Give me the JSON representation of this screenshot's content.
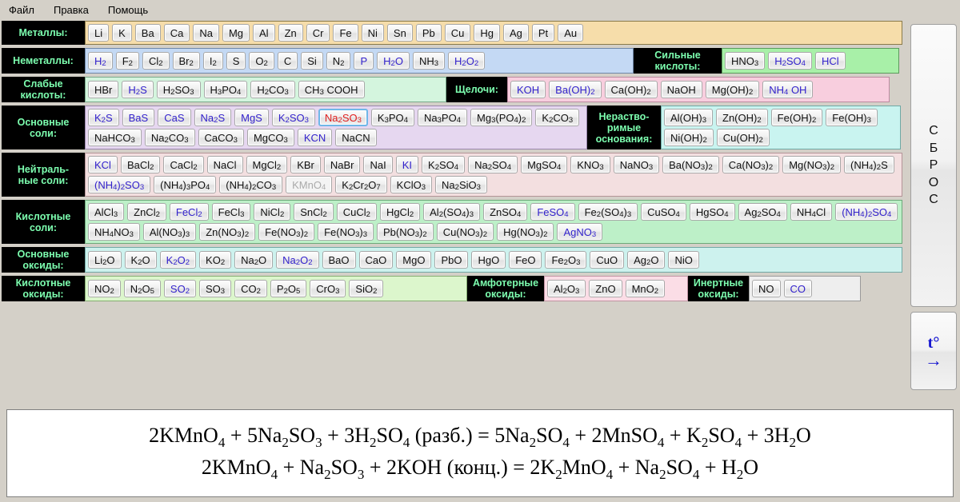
{
  "menu": {
    "items": [
      {
        "label": "Файл",
        "name": "menu-file"
      },
      {
        "label": "Правка",
        "name": "menu-edit"
      },
      {
        "label": "Помощь",
        "name": "menu-help"
      }
    ]
  },
  "sidebar": {
    "reset_label": "СБРОС",
    "reset_chars": [
      "С",
      "Б",
      "Р",
      "О",
      "С"
    ],
    "temp_label": "t°",
    "temp_arrow": "→"
  },
  "colors": {
    "label_bg": "#000000",
    "label_text": "#7dffb0",
    "selected_text": "#e02020",
    "selected_border": "#6fb7e8",
    "blue_text": "#3322cc",
    "disabled_text": "#aaaaaa",
    "metals_panel": "#f6ddaa",
    "nonmetals_panel": "#c4d9f4",
    "weak_acids_panel": "#d4f5de",
    "strong_acids_panel": "#a8f0a8",
    "alkalis_panel": "#f8cede",
    "base_salts_panel": "#e6d7f0",
    "insoluble_bases_panel": "#c9f4f0",
    "neutral_salts_panel": "#f3dfe0",
    "acid_salts_panel": "#bdf0c8",
    "base_oxides_panel": "#cdf2ee",
    "acid_oxides_panel": "#dcf6cc",
    "amphoteric_oxides_panel": "#fbdde6",
    "inert_oxides_panel": "#eeeeee"
  },
  "groups": {
    "metals": {
      "label": "Металлы:",
      "items": [
        {
          "f": "Li"
        },
        {
          "f": "K"
        },
        {
          "f": "Ba"
        },
        {
          "f": "Ca"
        },
        {
          "f": "Na"
        },
        {
          "f": "Mg"
        },
        {
          "f": "Al"
        },
        {
          "f": "Zn"
        },
        {
          "f": "Cr"
        },
        {
          "f": "Fe"
        },
        {
          "f": "Ni"
        },
        {
          "f": "Sn"
        },
        {
          "f": "Pb"
        },
        {
          "f": "Cu"
        },
        {
          "f": "Hg"
        },
        {
          "f": "Ag"
        },
        {
          "f": "Pt"
        },
        {
          "f": "Au"
        }
      ]
    },
    "nonmetals": {
      "label": "Неметаллы:",
      "items": [
        {
          "f": "H|2",
          "s": "blue"
        },
        {
          "f": "F|2"
        },
        {
          "f": "Cl|2"
        },
        {
          "f": "Br|2"
        },
        {
          "f": "I|2"
        },
        {
          "f": "S"
        },
        {
          "f": "O|2"
        },
        {
          "f": "C"
        },
        {
          "f": "Si"
        },
        {
          "f": "N|2"
        },
        {
          "f": "P",
          "s": "blue"
        },
        {
          "f": "H|2|O",
          "s": "blue"
        },
        {
          "f": "NH|3"
        },
        {
          "f": "H|2|O|2",
          "s": "blue"
        }
      ]
    },
    "strong_acids": {
      "label": "Сильные кислоты:",
      "label_lines": [
        "Сильные",
        "кислоты:"
      ],
      "items": [
        {
          "f": "HNO|3"
        },
        {
          "f": "H|2|SO|4",
          "s": "blue"
        },
        {
          "f": "HCl",
          "s": "blue"
        }
      ]
    },
    "weak_acids": {
      "label": "Слабые кислоты:",
      "label_lines": [
        "Слабые",
        "кислоты:"
      ],
      "items": [
        {
          "f": "HBr"
        },
        {
          "f": "H|2|S",
          "s": "blue"
        },
        {
          "f": "H|2|SO|3"
        },
        {
          "f": "H|3|PO|4"
        },
        {
          "f": "H|2|CO|3"
        },
        {
          "f": "CH|3| COOH"
        }
      ]
    },
    "alkalis": {
      "label": "Щелочи:",
      "items": [
        {
          "f": "KOH",
          "s": "blue"
        },
        {
          "f": "Ba(OH)|2",
          "s": "blue"
        },
        {
          "f": "Ca(OH)|2"
        },
        {
          "f": "NaOH"
        },
        {
          "f": "Mg(OH)|2"
        },
        {
          "f": "NH|4| OH",
          "s": "blue"
        }
      ]
    },
    "base_salts": {
      "label": "Основные соли:",
      "label_lines": [
        "Основные",
        "соли:"
      ],
      "items": [
        {
          "f": "K|2|S",
          "s": "blue"
        },
        {
          "f": "BaS",
          "s": "blue"
        },
        {
          "f": "CaS",
          "s": "blue"
        },
        {
          "f": "Na|2|S",
          "s": "blue"
        },
        {
          "f": "MgS",
          "s": "blue"
        },
        {
          "f": "K|2|SO|3",
          "s": "blue"
        },
        {
          "f": "Na|2|SO|3",
          "s": "sel"
        },
        {
          "f": "K|3|PO|4"
        },
        {
          "f": "Na|3|PO|4"
        },
        {
          "f": "Mg|3|(PO|4|)|2"
        },
        {
          "f": "K|2|CO|3"
        },
        {
          "f": "NaHCO|3"
        },
        {
          "f": "Na|2|CO|3"
        },
        {
          "f": "CaCO|3"
        },
        {
          "f": "MgCO|3"
        },
        {
          "f": "KCN",
          "s": "blue"
        },
        {
          "f": "NaCN"
        }
      ]
    },
    "insoluble_bases": {
      "label": "Нерастворимые основания:",
      "label_lines": [
        "Нераство-",
        "римые",
        "основания:"
      ],
      "items": [
        {
          "f": "Al(OH)|3"
        },
        {
          "f": "Zn(OH)|2"
        },
        {
          "f": "Fe(OH)|2"
        },
        {
          "f": "Fe(OH)|3"
        },
        {
          "f": "Ni(OH)|2"
        },
        {
          "f": "Cu(OH)|2"
        }
      ]
    },
    "neutral_salts": {
      "label": "Нейтральные соли:",
      "label_lines": [
        "Нейтраль-",
        "ные соли:"
      ],
      "items": [
        {
          "f": "KCl",
          "s": "blue"
        },
        {
          "f": "BaCl|2"
        },
        {
          "f": "CaCl|2"
        },
        {
          "f": "NaCl"
        },
        {
          "f": "MgCl|2"
        },
        {
          "f": "KBr"
        },
        {
          "f": "NaBr"
        },
        {
          "f": "NaI"
        },
        {
          "f": "KI",
          "s": "blue"
        },
        {
          "f": "K|2|SO|4"
        },
        {
          "f": "Na|2|SO|4"
        },
        {
          "f": "MgSO|4"
        },
        {
          "f": "KNO|3"
        },
        {
          "f": "NaNO|3"
        },
        {
          "f": "Ba(NO|3|)|2"
        },
        {
          "f": "Ca(NO|3|)|2"
        },
        {
          "f": "Mg(NO|3|)|2"
        },
        {
          "f": "(NH|4|)|2|S"
        },
        {
          "f": "(NH|4|)|2|SO|3",
          "s": "blue"
        },
        {
          "f": "(NH|4|)|3|PO|4"
        },
        {
          "f": "(NH|4|)|2|CO|3"
        },
        {
          "f": "KMnO|4",
          "s": "dis"
        },
        {
          "f": "K|2|Cr|2|O|7"
        },
        {
          "f": "KClO|3"
        },
        {
          "f": "Na|2|SiO|3"
        }
      ]
    },
    "acid_salts": {
      "label": "Кислотные соли:",
      "label_lines": [
        "Кислотные",
        "соли:"
      ],
      "items": [
        {
          "f": "AlCl|3"
        },
        {
          "f": "ZnCl|2"
        },
        {
          "f": "FeCl|2",
          "s": "blue"
        },
        {
          "f": "FeCl|3"
        },
        {
          "f": "NiCl|2"
        },
        {
          "f": "SnCl|2"
        },
        {
          "f": "CuCl|2"
        },
        {
          "f": "HgCl|2"
        },
        {
          "f": "Al|2|(SO|4|)|3"
        },
        {
          "f": "ZnSO|4"
        },
        {
          "f": "FeSO|4",
          "s": "blue"
        },
        {
          "f": "Fe|2|(SO|4|)|3"
        },
        {
          "f": "CuSO|4"
        },
        {
          "f": "HgSO|4"
        },
        {
          "f": "Ag|2|SO|4"
        },
        {
          "f": "NH|4|Cl"
        },
        {
          "f": "(NH|4|)|2|SO|4",
          "s": "blue"
        },
        {
          "f": "NH|4|NO|3"
        },
        {
          "f": "Al(NO|3|)|3"
        },
        {
          "f": "Zn(NO|3|)|2"
        },
        {
          "f": "Fe(NO|3|)|2"
        },
        {
          "f": "Fe(NO|3|)|3"
        },
        {
          "f": "Pb(NO|3|)|2"
        },
        {
          "f": "Cu(NO|3|)|2"
        },
        {
          "f": "Hg(NO|3|)|2"
        },
        {
          "f": "AgNO|3",
          "s": "blue"
        }
      ]
    },
    "base_oxides": {
      "label": "Основные оксиды:",
      "label_lines": [
        "Основные",
        "оксиды:"
      ],
      "items": [
        {
          "f": "Li|2|O"
        },
        {
          "f": "K|2|O"
        },
        {
          "f": "K|2|O|2",
          "s": "blue"
        },
        {
          "f": "KO|2"
        },
        {
          "f": "Na|2|O"
        },
        {
          "f": "Na|2|O|2",
          "s": "blue"
        },
        {
          "f": "BaO"
        },
        {
          "f": "CaO"
        },
        {
          "f": "MgO"
        },
        {
          "f": "PbO"
        },
        {
          "f": "HgO"
        },
        {
          "f": "FeO"
        },
        {
          "f": "Fe|2|O|3"
        },
        {
          "f": "CuO"
        },
        {
          "f": "Ag|2|O"
        },
        {
          "f": "NiO"
        }
      ]
    },
    "acid_oxides": {
      "label": "Кислотные оксиды:",
      "label_lines": [
        "Кислотные",
        "оксиды:"
      ],
      "items": [
        {
          "f": "NO|2"
        },
        {
          "f": "N|2|O|5"
        },
        {
          "f": "SO|2",
          "s": "blue"
        },
        {
          "f": "SO|3"
        },
        {
          "f": "CO|2"
        },
        {
          "f": "P|2|O|5"
        },
        {
          "f": "CrO|3"
        },
        {
          "f": "SiO|2"
        }
      ]
    },
    "amphoteric_oxides": {
      "label": "Амфотерные оксиды:",
      "label_lines": [
        "Амфотерные",
        "оксиды:"
      ],
      "items": [
        {
          "f": "Al|2|O|3"
        },
        {
          "f": "ZnO"
        },
        {
          "f": "MnO|2"
        }
      ]
    },
    "inert_oxides": {
      "label": "Инертные оксиды:",
      "label_lines": [
        "Инертные",
        "оксиды:"
      ],
      "items": [
        {
          "f": "NO"
        },
        {
          "f": "CO",
          "s": "blue"
        }
      ]
    }
  },
  "equations": [
    "2KMnO|4| + 5Na|2|SO|3| + 3H|2|SO|4| (разб.) = 5Na|2|SO|4| + 2MnSO|4| + K|2|SO|4| + 3H|2|O",
    "2KMnO|4| + Na|2|SO|3| + 2KOH (конц.) = 2K|2|MnO|4| + Na|2|SO|4| + H|2|O"
  ]
}
